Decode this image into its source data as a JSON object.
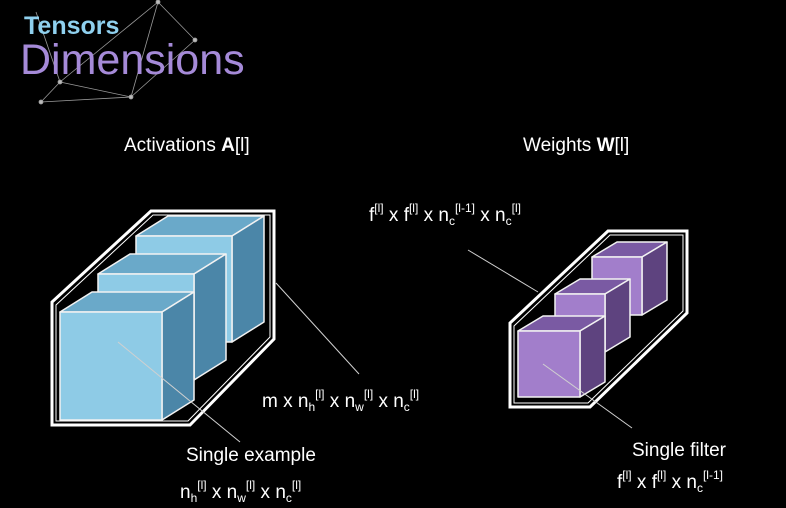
{
  "brand": {
    "line1": "Tensors",
    "line2": "Dimensions"
  },
  "colors": {
    "background": "#000000",
    "activation_front": "#8ecbe6",
    "activation_top": "#6aa9c9",
    "activation_side": "#4b86a8",
    "filter_front": "#a27ecb",
    "filter_top": "#7a5aa3",
    "filter_side": "#5e437f",
    "brand_tensors": "#8fd0ee",
    "brand_dimensions": "#a58ad8"
  },
  "activations": {
    "title_plain": "Activations ",
    "title_bold": "A",
    "title_index": "[l]",
    "shape": {
      "m": "m",
      "x": "x",
      "n": "n",
      "h": "h",
      "w": "w",
      "c": "c",
      "l": "[l]"
    },
    "example_label": "Single example"
  },
  "weights": {
    "title_plain": "Weights ",
    "title_bold": "W",
    "title_index": "[l]",
    "shape": {
      "f": "f",
      "x": "x",
      "n": "n",
      "c": "c",
      "l": "[l]",
      "lm1": "[l-1]"
    },
    "filter_label": "Single filter"
  }
}
